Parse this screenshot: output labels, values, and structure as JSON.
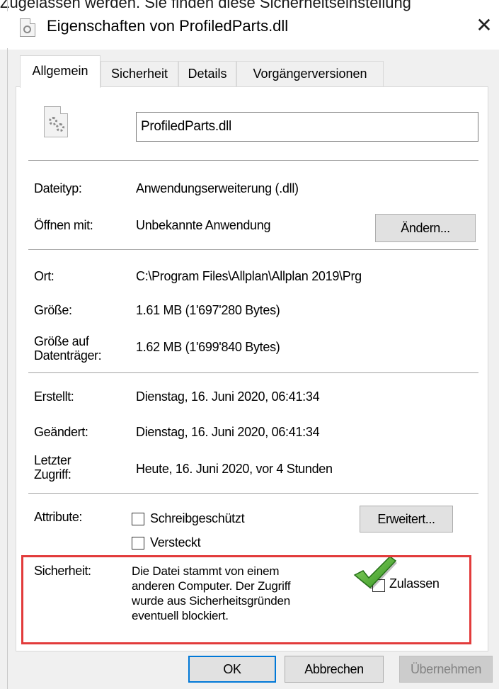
{
  "top_cut_text": "Zugelassen werden. Sie finden diese Sicherheitseinstellung",
  "window": {
    "title": "Eigenschaften von ProfiledParts.dll",
    "close_glyph": "✕",
    "icon": "file-gear-icon"
  },
  "tabs": [
    {
      "label": "Allgemein",
      "active": true
    },
    {
      "label": "Sicherheit",
      "active": false
    },
    {
      "label": "Details",
      "active": false
    },
    {
      "label": "Vorgängerversionen",
      "active": false
    }
  ],
  "general": {
    "file_name": "ProfiledParts.dll",
    "file_icon": "dll-gear-icon",
    "type_label": "Dateityp:",
    "type_value": "Anwendungserweiterung (.dll)",
    "opens_with_label": "Öffnen mit:",
    "opens_with_value": "Unbekannte Anwendung",
    "change_button": "Ändern...",
    "location_label": "Ort:",
    "location_value": "C:\\Program Files\\Allplan\\Allplan 2019\\Prg",
    "size_label": "Größe:",
    "size_value": "1.61 MB (1'697'280 Bytes)",
    "size_on_disk_label": "Größe auf Datenträger:",
    "size_on_disk_value": "1.62 MB (1'699'840 Bytes)",
    "created_label": "Erstellt:",
    "created_value": "Dienstag, 16. Juni 2020, 06:41:34",
    "modified_label": "Geändert:",
    "modified_value": "Dienstag, 16. Juni 2020, 06:41:34",
    "accessed_label": "Letzter Zugriff:",
    "accessed_value": "Heute, 16. Juni 2020, vor 4 Stunden",
    "attributes_label": "Attribute:",
    "readonly_label": "Schreibgeschützt",
    "readonly_checked": false,
    "hidden_label": "Versteckt",
    "hidden_checked": false,
    "advanced_button": "Erweitert...",
    "security_label": "Sicherheit:",
    "security_text": "Die Datei stammt von einem anderen Computer. Der Zugriff wurde aus Sicherheitsgründen eventuell blockiert.",
    "unblock_label": "Zulassen",
    "unblock_checked": true,
    "highlight_color": "#e23b3b",
    "checkmark_color": "#3fae2a"
  },
  "footer": {
    "ok": "OK",
    "cancel": "Abbrechen",
    "apply": "Übernehmen"
  }
}
